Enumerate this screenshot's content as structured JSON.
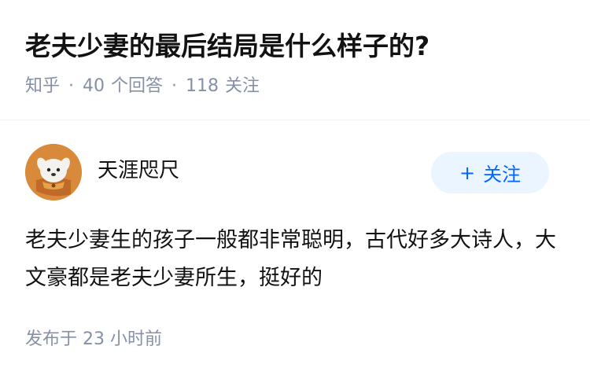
{
  "question": {
    "title": "老夫少妻的最后结局是什么样子的?",
    "source": "知乎",
    "answers_count": "40",
    "answers_label": "个回答",
    "followers_count": "118",
    "followers_label": "关注"
  },
  "answer": {
    "author_name": "天涯咫尺",
    "follow_label": "关注",
    "content": "老夫少妻生的孩子一般都非常聪明，古代好多大诗人，大文豪都是老夫少妻所生，挺好的",
    "time_prefix": "发布于",
    "time_value": "23 小时前"
  },
  "colors": {
    "accent": "#0066ff",
    "follow_bg": "#ebf5ff",
    "meta_text": "#8590a6",
    "avatar_bg": "#d9893a"
  },
  "icons": {
    "avatar": "cartoon-dog-avatar",
    "follow_plus": "plus-icon"
  }
}
